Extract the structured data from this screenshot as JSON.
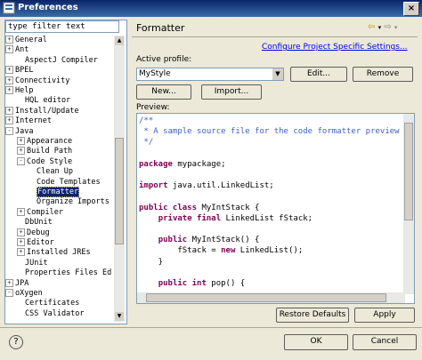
{
  "window": {
    "title": "Preferences",
    "close_label": "×"
  },
  "filter": {
    "value": "type filter text"
  },
  "tree": [
    {
      "label": "General",
      "toggle": "+"
    },
    {
      "label": "Ant",
      "toggle": "+"
    },
    {
      "label": "AspectJ Compiler",
      "toggle": ""
    },
    {
      "label": "BPEL",
      "toggle": "+"
    },
    {
      "label": "Connectivity",
      "toggle": "+"
    },
    {
      "label": "Help",
      "toggle": "+"
    },
    {
      "label": "HQL editor",
      "toggle": ""
    },
    {
      "label": "Install/Update",
      "toggle": "+"
    },
    {
      "label": "Internet",
      "toggle": "+"
    },
    {
      "label": "Java",
      "toggle": "-"
    },
    {
      "label": "Appearance",
      "toggle": "+"
    },
    {
      "label": "Build Path",
      "toggle": "+"
    },
    {
      "label": "Code Style",
      "toggle": "-"
    },
    {
      "label": "Clean Up",
      "toggle": ""
    },
    {
      "label": "Code Templates",
      "toggle": ""
    },
    {
      "label": "Formatter",
      "toggle": "",
      "selected": true
    },
    {
      "label": "Organize Imports",
      "toggle": ""
    },
    {
      "label": "Compiler",
      "toggle": "+"
    },
    {
      "label": "DbUnit",
      "toggle": ""
    },
    {
      "label": "Debug",
      "toggle": "+"
    },
    {
      "label": "Editor",
      "toggle": "+"
    },
    {
      "label": "Installed JREs",
      "toggle": "+"
    },
    {
      "label": "JUnit",
      "toggle": ""
    },
    {
      "label": "Properties Files Ed",
      "toggle": ""
    },
    {
      "label": "JPA",
      "toggle": "+"
    },
    {
      "label": "oXygen",
      "toggle": "-"
    },
    {
      "label": "Certificates",
      "toggle": ""
    },
    {
      "label": "CSS Validator",
      "toggle": ""
    }
  ],
  "page": {
    "title": "Formatter",
    "link": "Configure Project Specific Settings...",
    "profile_label": "Active profile:",
    "profile_value": "MyStyle",
    "edit_label": "Edit...",
    "remove_label": "Remove",
    "new_label": "New...",
    "import_label": "Import...",
    "preview_label": "Preview:",
    "restore_label": "Restore Defaults",
    "apply_label": "Apply"
  },
  "preview_code": [
    {
      "parts": [
        {
          "t": "/**",
          "c": "cm"
        }
      ]
    },
    {
      "parts": [
        {
          "t": " * A sample source file for the code formatter preview",
          "c": "cm"
        }
      ]
    },
    {
      "parts": [
        {
          "t": " */",
          "c": "cm"
        }
      ]
    },
    {
      "parts": []
    },
    {
      "parts": [
        {
          "t": "package",
          "c": "kw"
        },
        {
          "t": " mypackage;"
        }
      ]
    },
    {
      "parts": []
    },
    {
      "parts": [
        {
          "t": "import",
          "c": "kw"
        },
        {
          "t": " java.util.LinkedList;"
        }
      ]
    },
    {
      "parts": []
    },
    {
      "parts": [
        {
          "t": "public class",
          "c": "kw"
        },
        {
          "t": " MyIntStack {"
        }
      ]
    },
    {
      "parts": [
        {
          "t": "    "
        },
        {
          "t": "private final",
          "c": "kw"
        },
        {
          "t": " LinkedList fStack;"
        }
      ]
    },
    {
      "parts": []
    },
    {
      "parts": [
        {
          "t": "    "
        },
        {
          "t": "public",
          "c": "kw"
        },
        {
          "t": " MyIntStack() {"
        }
      ]
    },
    {
      "parts": [
        {
          "t": "        fStack = "
        },
        {
          "t": "new",
          "c": "kw"
        },
        {
          "t": " LinkedList();"
        }
      ]
    },
    {
      "parts": [
        {
          "t": "    }"
        }
      ]
    },
    {
      "parts": []
    },
    {
      "parts": [
        {
          "t": "    "
        },
        {
          "t": "public int",
          "c": "kw"
        },
        {
          "t": " pop() {"
        }
      ]
    }
  ],
  "dialog": {
    "ok_label": "OK",
    "cancel_label": "Cancel",
    "help_label": "?"
  }
}
